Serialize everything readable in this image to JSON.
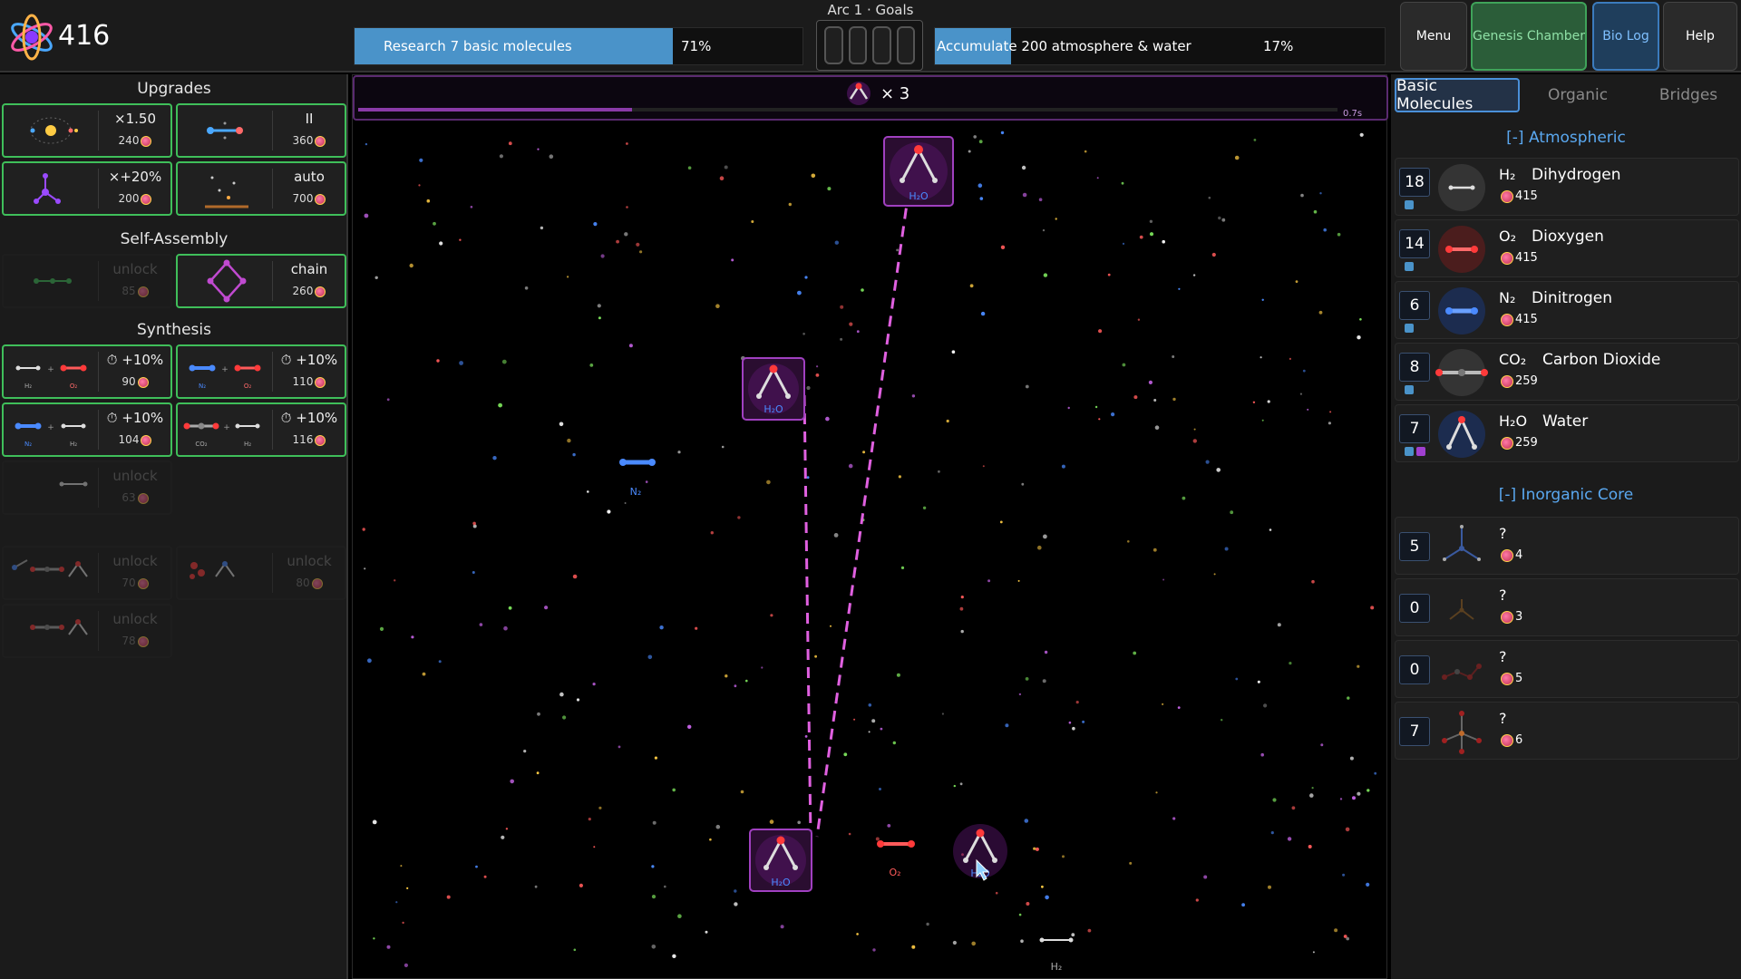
{
  "score": "416",
  "goals": {
    "title": "Arc 1 · Goals",
    "goal1": {
      "label": "Research 7 basic molecules",
      "percent_text": "71%",
      "progress": 0.71
    },
    "goal2": {
      "label": "Accumulate 200 atmosphere & water",
      "percent_text": "17%",
      "progress": 0.17
    }
  },
  "menu": {
    "menu": "Menu",
    "genesis": "Genesis Chamber",
    "biolog": "Bio Log",
    "help": "Help"
  },
  "left": {
    "upgrades_title": "Upgrades",
    "self_assembly_title": "Self-Assembly",
    "synthesis_title": "Synthesis",
    "upgrades": [
      {
        "t1": "×1.50",
        "cost": "240",
        "icon": "sun-orbit-icon"
      },
      {
        "t1": "II",
        "cost": "360",
        "icon": "molecule-link-icon"
      },
      {
        "t1": "×+20%",
        "cost": "200",
        "icon": "molecule-branch-icon"
      },
      {
        "t1": "auto",
        "cost": "700",
        "icon": "auto-collector-icon"
      }
    ],
    "self_assembly": [
      {
        "t1": "unlock",
        "cost": "85",
        "locked": true
      },
      {
        "t1": "chain",
        "cost": "260",
        "locked": false
      }
    ],
    "synthesis": [
      {
        "bonus": "+10%",
        "cost": "90",
        "a": "H₂",
        "b": "O₂"
      },
      {
        "bonus": "+10%",
        "cost": "110",
        "a": "N₂",
        "b": "O₂"
      },
      {
        "bonus": "+10%",
        "cost": "104",
        "a": "N₂",
        "b": "H₂"
      },
      {
        "bonus": "+10%",
        "cost": "116",
        "a": "CO₂",
        "b": "H₂"
      }
    ],
    "locked": [
      {
        "t1": "unlock",
        "cost": "63"
      },
      {
        "t1": "unlock",
        "cost": "70"
      },
      {
        "t1": "unlock",
        "cost": "80"
      },
      {
        "t1": "unlock",
        "cost": "78"
      }
    ]
  },
  "field": {
    "multiplier": "× 3",
    "timer": "0.7s",
    "progress": 0.28,
    "labels": {
      "h2o": "H₂O",
      "n2": "N₂",
      "o2": "O₂",
      "h2": "H₂"
    }
  },
  "right": {
    "tabs": {
      "basic": "Basic Molecules",
      "organic": "Organic",
      "bridges": "Bridges"
    },
    "atmospheric_title": "[-] Atmospheric",
    "inorganic_title": "[-] Inorganic Core",
    "atmospheric": [
      {
        "count": "18",
        "formula": "H₂",
        "name": "Dihydrogen",
        "price": "415"
      },
      {
        "count": "14",
        "formula": "O₂",
        "name": "Dioxygen",
        "price": "415"
      },
      {
        "count": "6",
        "formula": "N₂",
        "name": "Dinitrogen",
        "price": "415"
      },
      {
        "count": "8",
        "formula": "CO₂",
        "name": "Carbon Dioxide",
        "price": "259"
      },
      {
        "count": "7",
        "formula": "H₂O",
        "name": "Water",
        "price": "259"
      }
    ],
    "inorganic": [
      {
        "count": "5",
        "formula": "?",
        "price": "4"
      },
      {
        "count": "0",
        "formula": "?",
        "price": "3"
      },
      {
        "count": "0",
        "formula": "?",
        "price": "5"
      },
      {
        "count": "7",
        "formula": "?",
        "price": "6"
      }
    ]
  },
  "colors": {
    "accent_green": "#3fbf5a",
    "accent_blue": "#4a93c9",
    "field_purple": "#e060e0"
  }
}
